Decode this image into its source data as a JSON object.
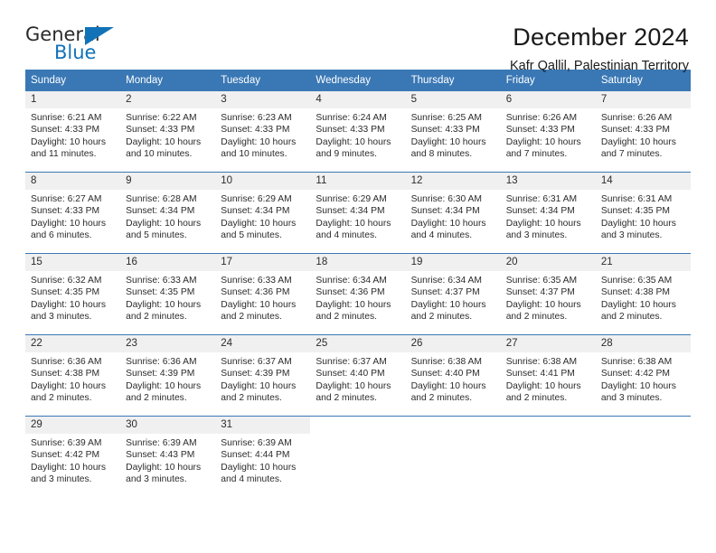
{
  "brand": {
    "name_top": "General",
    "name_bottom": "Blue",
    "accent_color": "#1272b8"
  },
  "header": {
    "title": "December 2024",
    "subtitle": "Kafr Qallil, Palestinian Territory"
  },
  "calendar": {
    "header_color": "#3a78b5",
    "daynum_band_color": "#f0f0f0",
    "weekdays": [
      "Sunday",
      "Monday",
      "Tuesday",
      "Wednesday",
      "Thursday",
      "Friday",
      "Saturday"
    ],
    "weeks": [
      [
        {
          "day": "1",
          "sunrise": "Sunrise: 6:21 AM",
          "sunset": "Sunset: 4:33 PM",
          "daylight_1": "Daylight: 10 hours",
          "daylight_2": "and 11 minutes."
        },
        {
          "day": "2",
          "sunrise": "Sunrise: 6:22 AM",
          "sunset": "Sunset: 4:33 PM",
          "daylight_1": "Daylight: 10 hours",
          "daylight_2": "and 10 minutes."
        },
        {
          "day": "3",
          "sunrise": "Sunrise: 6:23 AM",
          "sunset": "Sunset: 4:33 PM",
          "daylight_1": "Daylight: 10 hours",
          "daylight_2": "and 10 minutes."
        },
        {
          "day": "4",
          "sunrise": "Sunrise: 6:24 AM",
          "sunset": "Sunset: 4:33 PM",
          "daylight_1": "Daylight: 10 hours",
          "daylight_2": "and 9 minutes."
        },
        {
          "day": "5",
          "sunrise": "Sunrise: 6:25 AM",
          "sunset": "Sunset: 4:33 PM",
          "daylight_1": "Daylight: 10 hours",
          "daylight_2": "and 8 minutes."
        },
        {
          "day": "6",
          "sunrise": "Sunrise: 6:26 AM",
          "sunset": "Sunset: 4:33 PM",
          "daylight_1": "Daylight: 10 hours",
          "daylight_2": "and 7 minutes."
        },
        {
          "day": "7",
          "sunrise": "Sunrise: 6:26 AM",
          "sunset": "Sunset: 4:33 PM",
          "daylight_1": "Daylight: 10 hours",
          "daylight_2": "and 7 minutes."
        }
      ],
      [
        {
          "day": "8",
          "sunrise": "Sunrise: 6:27 AM",
          "sunset": "Sunset: 4:33 PM",
          "daylight_1": "Daylight: 10 hours",
          "daylight_2": "and 6 minutes."
        },
        {
          "day": "9",
          "sunrise": "Sunrise: 6:28 AM",
          "sunset": "Sunset: 4:34 PM",
          "daylight_1": "Daylight: 10 hours",
          "daylight_2": "and 5 minutes."
        },
        {
          "day": "10",
          "sunrise": "Sunrise: 6:29 AM",
          "sunset": "Sunset: 4:34 PM",
          "daylight_1": "Daylight: 10 hours",
          "daylight_2": "and 5 minutes."
        },
        {
          "day": "11",
          "sunrise": "Sunrise: 6:29 AM",
          "sunset": "Sunset: 4:34 PM",
          "daylight_1": "Daylight: 10 hours",
          "daylight_2": "and 4 minutes."
        },
        {
          "day": "12",
          "sunrise": "Sunrise: 6:30 AM",
          "sunset": "Sunset: 4:34 PM",
          "daylight_1": "Daylight: 10 hours",
          "daylight_2": "and 4 minutes."
        },
        {
          "day": "13",
          "sunrise": "Sunrise: 6:31 AM",
          "sunset": "Sunset: 4:34 PM",
          "daylight_1": "Daylight: 10 hours",
          "daylight_2": "and 3 minutes."
        },
        {
          "day": "14",
          "sunrise": "Sunrise: 6:31 AM",
          "sunset": "Sunset: 4:35 PM",
          "daylight_1": "Daylight: 10 hours",
          "daylight_2": "and 3 minutes."
        }
      ],
      [
        {
          "day": "15",
          "sunrise": "Sunrise: 6:32 AM",
          "sunset": "Sunset: 4:35 PM",
          "daylight_1": "Daylight: 10 hours",
          "daylight_2": "and 3 minutes."
        },
        {
          "day": "16",
          "sunrise": "Sunrise: 6:33 AM",
          "sunset": "Sunset: 4:35 PM",
          "daylight_1": "Daylight: 10 hours",
          "daylight_2": "and 2 minutes."
        },
        {
          "day": "17",
          "sunrise": "Sunrise: 6:33 AM",
          "sunset": "Sunset: 4:36 PM",
          "daylight_1": "Daylight: 10 hours",
          "daylight_2": "and 2 minutes."
        },
        {
          "day": "18",
          "sunrise": "Sunrise: 6:34 AM",
          "sunset": "Sunset: 4:36 PM",
          "daylight_1": "Daylight: 10 hours",
          "daylight_2": "and 2 minutes."
        },
        {
          "day": "19",
          "sunrise": "Sunrise: 6:34 AM",
          "sunset": "Sunset: 4:37 PM",
          "daylight_1": "Daylight: 10 hours",
          "daylight_2": "and 2 minutes."
        },
        {
          "day": "20",
          "sunrise": "Sunrise: 6:35 AM",
          "sunset": "Sunset: 4:37 PM",
          "daylight_1": "Daylight: 10 hours",
          "daylight_2": "and 2 minutes."
        },
        {
          "day": "21",
          "sunrise": "Sunrise: 6:35 AM",
          "sunset": "Sunset: 4:38 PM",
          "daylight_1": "Daylight: 10 hours",
          "daylight_2": "and 2 minutes."
        }
      ],
      [
        {
          "day": "22",
          "sunrise": "Sunrise: 6:36 AM",
          "sunset": "Sunset: 4:38 PM",
          "daylight_1": "Daylight: 10 hours",
          "daylight_2": "and 2 minutes."
        },
        {
          "day": "23",
          "sunrise": "Sunrise: 6:36 AM",
          "sunset": "Sunset: 4:39 PM",
          "daylight_1": "Daylight: 10 hours",
          "daylight_2": "and 2 minutes."
        },
        {
          "day": "24",
          "sunrise": "Sunrise: 6:37 AM",
          "sunset": "Sunset: 4:39 PM",
          "daylight_1": "Daylight: 10 hours",
          "daylight_2": "and 2 minutes."
        },
        {
          "day": "25",
          "sunrise": "Sunrise: 6:37 AM",
          "sunset": "Sunset: 4:40 PM",
          "daylight_1": "Daylight: 10 hours",
          "daylight_2": "and 2 minutes."
        },
        {
          "day": "26",
          "sunrise": "Sunrise: 6:38 AM",
          "sunset": "Sunset: 4:40 PM",
          "daylight_1": "Daylight: 10 hours",
          "daylight_2": "and 2 minutes."
        },
        {
          "day": "27",
          "sunrise": "Sunrise: 6:38 AM",
          "sunset": "Sunset: 4:41 PM",
          "daylight_1": "Daylight: 10 hours",
          "daylight_2": "and 2 minutes."
        },
        {
          "day": "28",
          "sunrise": "Sunrise: 6:38 AM",
          "sunset": "Sunset: 4:42 PM",
          "daylight_1": "Daylight: 10 hours",
          "daylight_2": "and 3 minutes."
        }
      ],
      [
        {
          "day": "29",
          "sunrise": "Sunrise: 6:39 AM",
          "sunset": "Sunset: 4:42 PM",
          "daylight_1": "Daylight: 10 hours",
          "daylight_2": "and 3 minutes."
        },
        {
          "day": "30",
          "sunrise": "Sunrise: 6:39 AM",
          "sunset": "Sunset: 4:43 PM",
          "daylight_1": "Daylight: 10 hours",
          "daylight_2": "and 3 minutes."
        },
        {
          "day": "31",
          "sunrise": "Sunrise: 6:39 AM",
          "sunset": "Sunset: 4:44 PM",
          "daylight_1": "Daylight: 10 hours",
          "daylight_2": "and 4 minutes."
        },
        {
          "day": "",
          "sunrise": "",
          "sunset": "",
          "daylight_1": "",
          "daylight_2": ""
        },
        {
          "day": "",
          "sunrise": "",
          "sunset": "",
          "daylight_1": "",
          "daylight_2": ""
        },
        {
          "day": "",
          "sunrise": "",
          "sunset": "",
          "daylight_1": "",
          "daylight_2": ""
        },
        {
          "day": "",
          "sunrise": "",
          "sunset": "",
          "daylight_1": "",
          "daylight_2": ""
        }
      ]
    ]
  }
}
